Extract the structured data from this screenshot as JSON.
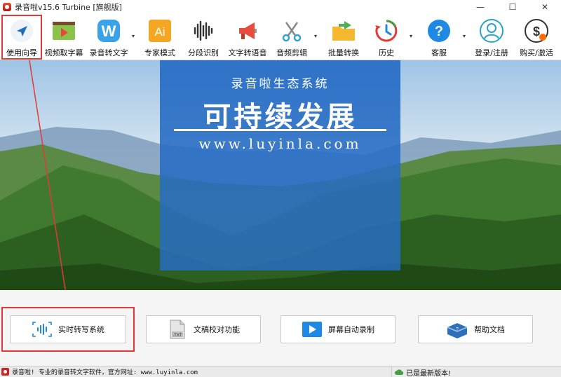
{
  "window": {
    "title": "录音啦v15.6 Turbine [旗舰版]",
    "controls": {
      "minimize": "—",
      "maximize": "☐",
      "close": "✕"
    }
  },
  "toolbar": {
    "items": [
      {
        "label": "使用向导",
        "icon": "navigation-arrow-icon",
        "dropdown": false
      },
      {
        "label": "视频取字幕",
        "icon": "video-play-icon",
        "dropdown": false
      },
      {
        "label": "录音转文字",
        "icon": "w-letter-icon",
        "dropdown": true
      },
      {
        "label": "专家模式",
        "icon": "ai-icon",
        "dropdown": false
      },
      {
        "label": "分段识别",
        "icon": "waveform-icon",
        "dropdown": false
      },
      {
        "label": "文字转语音",
        "icon": "megaphone-icon",
        "dropdown": false
      },
      {
        "label": "音频剪辑",
        "icon": "scissors-icon",
        "dropdown": true
      },
      {
        "label": "批量转换",
        "icon": "folder-arrow-icon",
        "dropdown": false
      },
      {
        "label": "历史",
        "icon": "history-clock-icon",
        "dropdown": true
      },
      {
        "label": "客服",
        "icon": "help-question-icon",
        "dropdown": true
      },
      {
        "label": "登录/注册",
        "icon": "user-icon",
        "dropdown": false
      },
      {
        "label": "购买/激活",
        "icon": "purchase-dollar-icon",
        "dropdown": false
      }
    ],
    "dropdown_glyph": "▾"
  },
  "banner": {
    "subtitle": "录音啦生态系统",
    "title": "可持续发展",
    "url": "www.luyinla.com"
  },
  "features": [
    {
      "label": "实时转写系统",
      "icon": "realtime-transcribe-icon"
    },
    {
      "label": "文稿校对功能",
      "icon": "txt-document-icon"
    },
    {
      "label": "屏幕自动录制",
      "icon": "screen-record-icon"
    },
    {
      "label": "帮助文档",
      "icon": "help-book-icon"
    }
  ],
  "status": {
    "left": "录音啦! 专业的录音转文字软件，官方网址: www.luyinla.com",
    "right": "已是最新版本!"
  },
  "colors": {
    "highlight": "#e53935",
    "banner_blue": "#266cc4",
    "accent_blue": "#1e88e5"
  }
}
